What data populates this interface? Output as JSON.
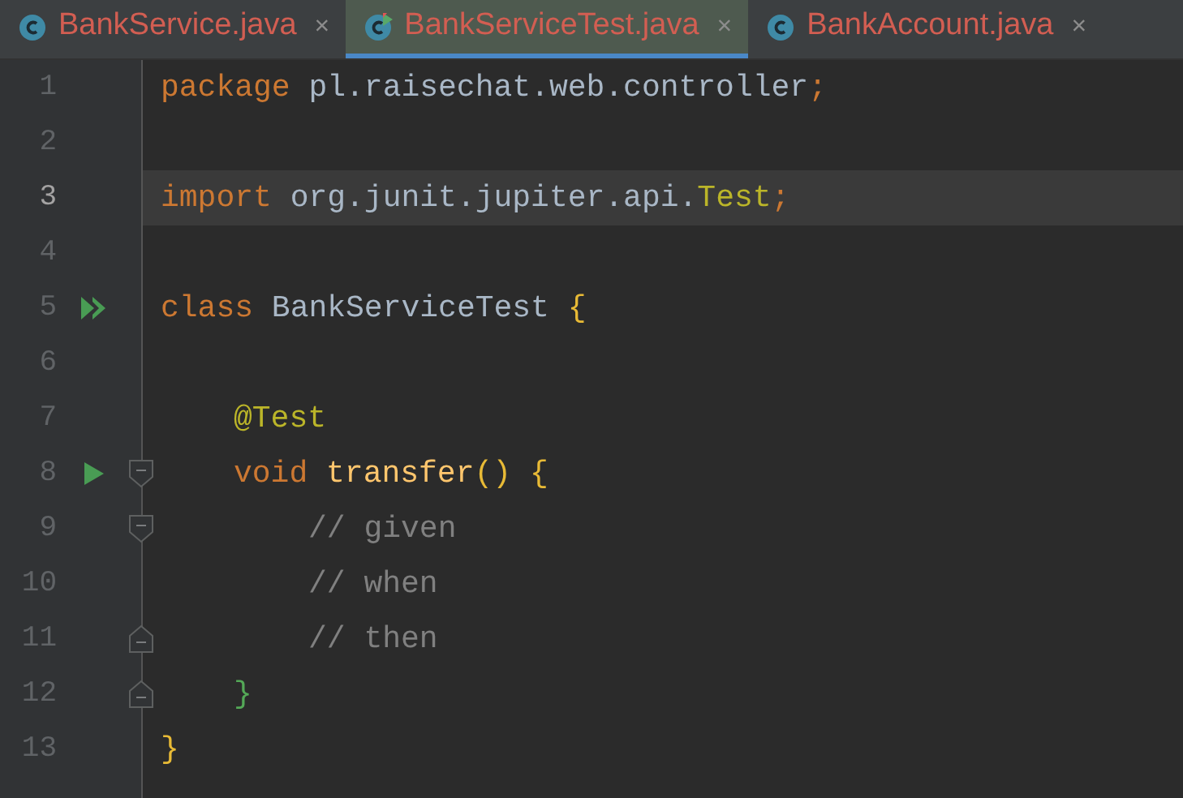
{
  "tabs": [
    {
      "label": "BankService.java",
      "kind": "class",
      "close": "×",
      "selected": false
    },
    {
      "label": "BankServiceTest.java",
      "kind": "test",
      "close": "×",
      "selected": true
    },
    {
      "label": "BankAccount.java",
      "kind": "class",
      "close": "×",
      "selected": false
    }
  ],
  "lines": [
    {
      "number": "1",
      "current": false,
      "tokens": [
        {
          "text": "package ",
          "kind": "keyword"
        },
        {
          "text": "pl.raisechat.web.controller",
          "kind": "plain"
        },
        {
          "text": ";",
          "kind": "keyword"
        }
      ]
    },
    {
      "number": "2",
      "current": false
    },
    {
      "number": "3",
      "current": true,
      "tokens": [
        {
          "text": "import ",
          "kind": "keyword"
        },
        {
          "text": "org.junit.jupiter.api.",
          "kind": "plain"
        },
        {
          "text": "Test",
          "kind": "annotation"
        },
        {
          "text": ";",
          "kind": "keyword"
        }
      ]
    },
    {
      "number": "4",
      "current": false
    },
    {
      "number": "5",
      "current": false,
      "gutter": {
        "kind": "run-all"
      },
      "tokens": [
        {
          "text": "class ",
          "kind": "keyword"
        },
        {
          "text": "BankServiceTest ",
          "kind": "plain"
        },
        {
          "text": "{",
          "kind": "brace",
          "color": "#e8ba36"
        }
      ],
      "children": [
        {
          "number": "6",
          "current": false
        },
        {
          "number": "7",
          "current": false,
          "tokens": [
            {
              "text": "@Test",
              "kind": "annotation"
            }
          ]
        },
        {
          "number": "8",
          "current": false,
          "gutter": {
            "kind": "run"
          },
          "fold": {
            "kind": "start"
          },
          "tokens": [
            {
              "text": "void ",
              "kind": "keyword"
            },
            {
              "text": "transfer",
              "kind": "function"
            },
            {
              "text": "() {",
              "kind": "brace",
              "color": "#e8ba36"
            }
          ],
          "children": [
            {
              "number": "9",
              "current": false,
              "fold": {
                "kind": "start"
              },
              "tokens": [
                {
                  "text": "// given",
                  "kind": "comment"
                }
              ]
            },
            {
              "number": "10",
              "current": false,
              "tokens": [
                {
                  "text": "// when",
                  "kind": "comment"
                }
              ]
            },
            {
              "number": "11",
              "current": false,
              "fold": {
                "kind": "end"
              },
              "tokens": [
                {
                  "text": "// then",
                  "kind": "comment"
                }
              ]
            }
          ]
        },
        {
          "number": "12",
          "current": false,
          "fold": {
            "kind": "end"
          },
          "tokens": [
            {
              "text": "}",
              "kind": "brace",
              "color": "#54a857"
            }
          ]
        }
      ]
    },
    {
      "number": "13",
      "current": false,
      "tokens": [
        {
          "text": "}",
          "kind": "brace",
          "color": "#e8ba36"
        }
      ]
    }
  ]
}
